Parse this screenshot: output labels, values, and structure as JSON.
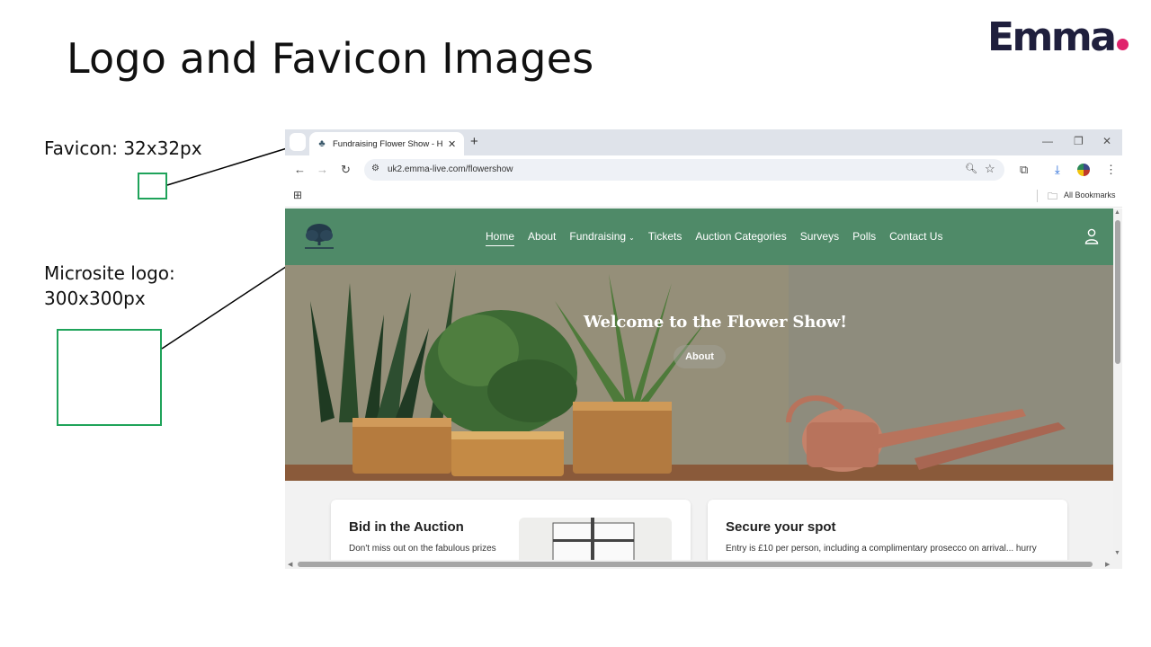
{
  "slide": {
    "title": "Logo and Favicon Images",
    "brand": "Emma",
    "favicon_label": "Favicon: 32x32px",
    "logo_label_line1": "Microsite logo:",
    "logo_label_line2": "300x300px"
  },
  "browser": {
    "tab_title": "Fundraising Flower Show - Hom",
    "url": "uk2.emma-live.com/flowershow",
    "bookmarks_label": "All Bookmarks"
  },
  "site": {
    "nav": [
      {
        "label": "Home",
        "active": true
      },
      {
        "label": "About"
      },
      {
        "label": "Fundraising",
        "has_dropdown": true
      },
      {
        "label": "Tickets"
      },
      {
        "label": "Auction Categories"
      },
      {
        "label": "Surveys"
      },
      {
        "label": "Polls"
      },
      {
        "label": "Contact Us"
      }
    ],
    "hero_title": "Welcome to the Flower Show!",
    "hero_button": "About",
    "cards": [
      {
        "title": "Bid in the Auction",
        "text": "Don't miss out on the fabulous prizes"
      },
      {
        "title": "Secure your spot",
        "text": "Entry is £10 per person, including a complimentary prosecco on arrival... hurry"
      }
    ]
  },
  "colors": {
    "nav_green": "#4f8a68",
    "annotation_green": "#1fa35a",
    "brand_navy": "#1f1f3d",
    "brand_dot": "#e0236c"
  }
}
